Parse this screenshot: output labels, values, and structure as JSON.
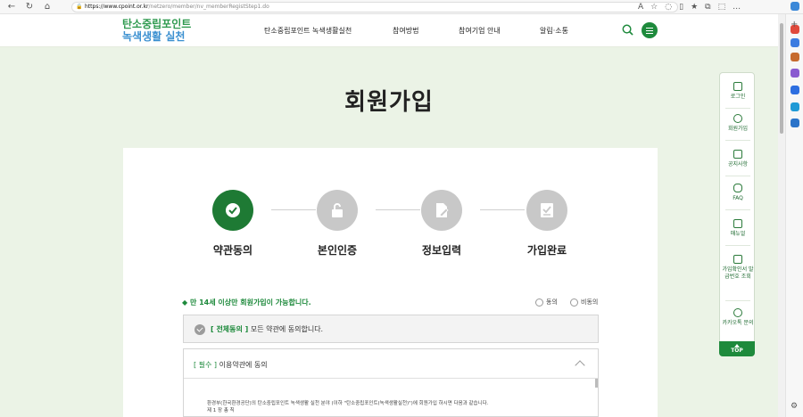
{
  "browser": {
    "url_host": "https://www.cpoint.or.kr",
    "url_path": "/netzero/member/nv_memberRegistStep1.do"
  },
  "site": {
    "logo_line1": "탄소중립포인트",
    "logo_line2": "녹색생활 실천",
    "nav": [
      "탄소중립포인트 녹색생활실천",
      "참여방법",
      "참여기업 안내",
      "알림·소통"
    ]
  },
  "page": {
    "title": "회원가입"
  },
  "steps": [
    {
      "label": "약관동의",
      "active": true
    },
    {
      "label": "본인인증",
      "active": false
    },
    {
      "label": "정보입력",
      "active": false
    },
    {
      "label": "가입완료",
      "active": false
    }
  ],
  "agreement": {
    "age_notice": "◆ 만 14세 이상만 회원가입이 가능합니다.",
    "radio_agree": "동의",
    "radio_disagree": "비동의",
    "all_prefix": "[ 전체동의 ]",
    "all_text": "모든 약관에 동의합니다.",
    "term1_req": "[ 필수 ]",
    "term1_title": "이용약관에 동의",
    "term1_body": "환경부(한국환경공단)의 탄소중립포인트 녹색생활 실천 분야 (이하 \"탄소중립포인트(녹색생활실천)\")에 회원가입 하시면 다음과 같습니다.",
    "term1_chapter": "제 1 장 총 칙"
  },
  "quick_menu": [
    {
      "label": "로그인",
      "icon": "lock-icon"
    },
    {
      "label": "회원가입",
      "icon": "user-icon"
    },
    {
      "label": "공지사항",
      "icon": "megaphone-icon"
    },
    {
      "label": "FAQ",
      "icon": "chat-icon"
    },
    {
      "label": "매뉴얼",
      "icon": "book-icon"
    },
    {
      "label": "가입확인서 발급번호 조회",
      "icon": "document-icon"
    },
    {
      "label": "카카오톡 문의",
      "icon": "kakao-icon"
    }
  ],
  "quick_top": "TOP",
  "colors": {
    "brand_green": "#1e8a3c",
    "bg_green": "#ebf3e6",
    "step_inactive": "#c8c8c8"
  }
}
